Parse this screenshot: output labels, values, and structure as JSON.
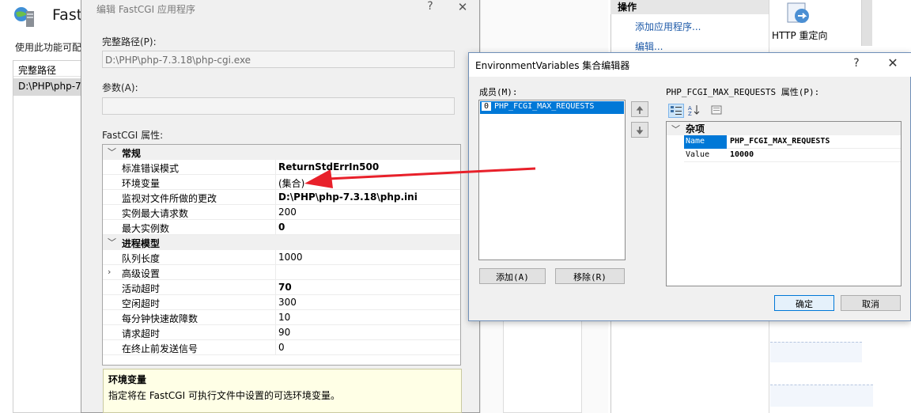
{
  "iis": {
    "title": "Fast",
    "description": "使用此功能可配",
    "table_header": "完整路径",
    "table_row": "D:\\PHP\\php-7",
    "actions_title": "操作",
    "actions": [
      "添加应用程序...",
      "编辑..."
    ],
    "http_label": "HTTP 重定向"
  },
  "fastcgi_dialog": {
    "title": "编辑 FastCGI 应用程序",
    "help_glyph": "?",
    "close_glyph": "✕",
    "full_path_label": "完整路径(P):",
    "full_path_value": "D:\\PHP\\php-7.3.18\\php-cgi.exe",
    "args_label": "参数(A):",
    "args_value": "",
    "props_label": "FastCGI 属性:",
    "categories": {
      "general": "常规",
      "process_model": "进程模型"
    },
    "general_rows": [
      {
        "label": "标准错误模式",
        "value": "ReturnStdErrIn500"
      },
      {
        "label": "环境变量",
        "value": "(集合)"
      },
      {
        "label": "监视对文件所做的更改",
        "value": "D:\\PHP\\php-7.3.18\\php.ini"
      },
      {
        "label": "实例最大请求数",
        "value": "200"
      },
      {
        "label": "最大实例数",
        "value": "0"
      }
    ],
    "process_rows": [
      {
        "label": "队列长度",
        "value": "1000"
      },
      {
        "label": "高级设置",
        "value": ""
      },
      {
        "label": "活动超时",
        "value": "70"
      },
      {
        "label": "空闲超时",
        "value": "300"
      },
      {
        "label": "每分钟快速故障数",
        "value": "10"
      },
      {
        "label": "请求超时",
        "value": "90"
      },
      {
        "label": "在终止前发送信号",
        "value": "0"
      }
    ],
    "help_title": "环境变量",
    "help_text": "指定将在 FastCGI 可执行文件中设置的可选环境变量。"
  },
  "env_dialog": {
    "title": "EnvironmentVariables 集合编辑器",
    "help_glyph": "?",
    "close_glyph": "✕",
    "members_label": "成员(M):",
    "members": [
      {
        "index": "0",
        "name": "PHP_FCGI_MAX_REQUESTS"
      }
    ],
    "up_glyph": "🠉",
    "down_glyph": "🠋",
    "add_button": "添加(A)",
    "remove_button": "移除(R)",
    "props_label": "PHP_FCGI_MAX_REQUESTS 属性(P):",
    "category": "杂项",
    "props": [
      {
        "key": "Name",
        "value": "PHP_FCGI_MAX_REQUESTS"
      },
      {
        "key": "Value",
        "value": "10000"
      }
    ],
    "ok_button": "确定",
    "cancel_button": "取消"
  },
  "colors": {
    "selection": "#0078d7",
    "annotation_arrow": "#e8202a",
    "help_box": "#ffffe6"
  }
}
